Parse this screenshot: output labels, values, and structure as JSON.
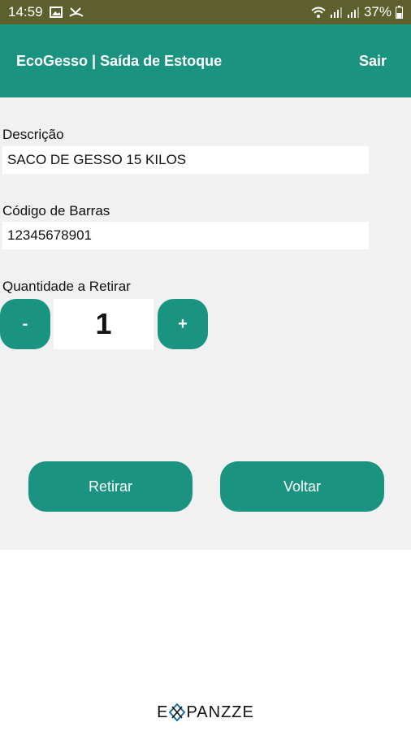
{
  "status_bar": {
    "time": "14:59",
    "battery": "37%"
  },
  "app_bar": {
    "title": "EcoGesso | Saída de Estoque",
    "exit_label": "Sair"
  },
  "form": {
    "description_label": "Descrição",
    "description_value": "SACO DE GESSO 15 KILOS",
    "barcode_label": "Código de Barras",
    "barcode_value": "12345678901",
    "quantity_label": "Quantidade a Retirar",
    "quantity_value": "1",
    "decrement_label": "-",
    "increment_label": "+"
  },
  "actions": {
    "withdraw_label": "Retirar",
    "back_label": "Voltar"
  },
  "footer": {
    "logo_prefix": "E",
    "logo_suffix": "PANZZE"
  },
  "colors": {
    "primary": "#1a9381",
    "status_bar": "#5d5f2c",
    "content_bg": "#f1f1f1"
  }
}
